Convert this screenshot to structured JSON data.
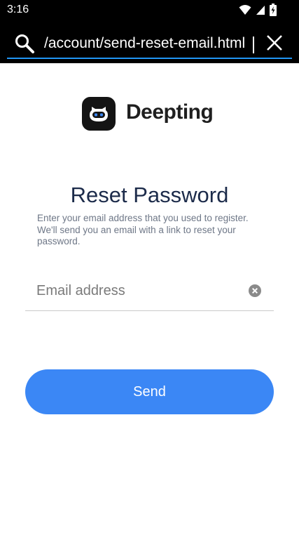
{
  "status_bar": {
    "time": "3:16",
    "icons": [
      "wifi-icon",
      "cellular-signal-icon",
      "battery-charging-icon"
    ]
  },
  "address_bar": {
    "url": "/account/send-reset-email.html",
    "icons": [
      "search-icon",
      "close-icon"
    ]
  },
  "brand": {
    "name": "Deepting",
    "logo_icon": "robot-face-logo"
  },
  "reset_form": {
    "title": "Reset Password",
    "instructions": "Enter your email address that you used to register. We'll send you an email with a link to reset your password.",
    "email_value": "",
    "email_placeholder": "Email address",
    "clear_icon": "clear-circle-icon",
    "send_label": "Send"
  },
  "colors": {
    "accent": "#3b87f5",
    "address_underline": "#2196f3",
    "title": "#1c2b4a",
    "instructions": "#6e7787",
    "status_bar_bg": "#000000"
  }
}
